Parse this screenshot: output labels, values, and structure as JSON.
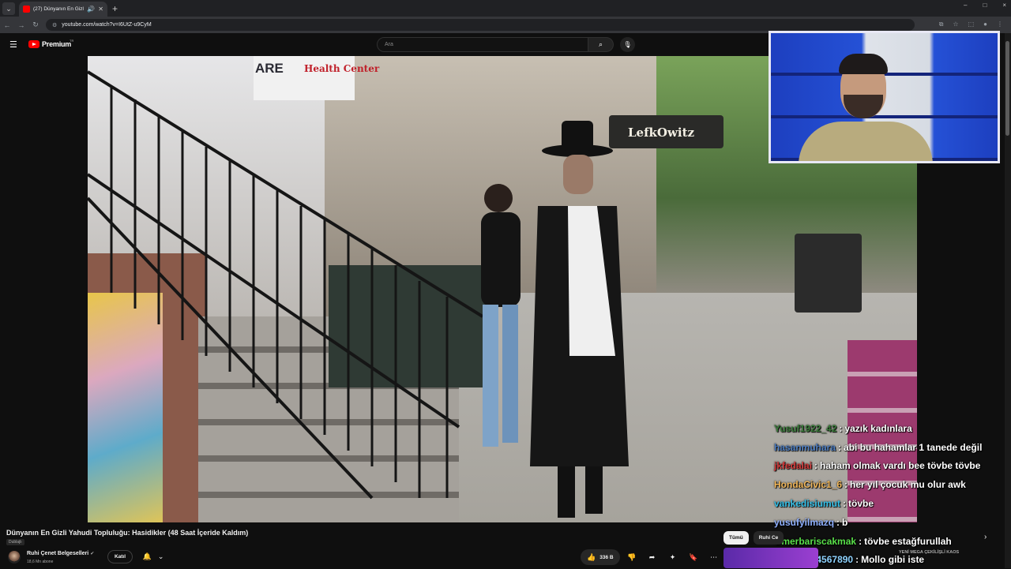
{
  "browser": {
    "tab_menu_icon": "chevron-down",
    "tab_title": "(27) Dünyanın En Gizli Yahu",
    "url": "youtube.com/watch?v=I6UtZ-u9CyM",
    "window_controls": [
      "–",
      "□",
      "×"
    ]
  },
  "youtube": {
    "logo_text": "Premium",
    "logo_region": "TR",
    "search_placeholder": "Ara",
    "colors": {
      "brand": "#ff0000",
      "background": "#0f0f0f"
    }
  },
  "video_scene": {
    "sign_are": "ARE",
    "sign_health_center": "Health Center",
    "sign_store": "LefkOwitz"
  },
  "chat": [
    {
      "user": "Yusuf1922_42",
      "color": "#3b7d3b",
      "message": "yazık kadınlara"
    },
    {
      "user": "hasanmuhara",
      "color": "#4f7fc2",
      "message": "abi bu hahamlar 1 tanede değil"
    },
    {
      "user": "jkfedalai",
      "color": "#d43a3a",
      "message": "haham olmak vardı bee tövbe tövbe"
    },
    {
      "user": "HondaCivic1_6",
      "color": "#f0b65a",
      "message": "her yıl çocuk mu olur awk"
    },
    {
      "user": "vankedisiumut",
      "color": "#35c0e8",
      "message": "tövbe"
    },
    {
      "user": "yusufyilmazq",
      "color": "#8fb0ff",
      "message": "b"
    },
    {
      "user": "Omerbariscakmak",
      "color": "#59e04a",
      "message": "tövbe estağfurullah"
    },
    {
      "user": "Kayra1234567890",
      "color": "#8fd3ff",
      "message": "Mollo gibi iste"
    }
  ],
  "video_info": {
    "title": "Dünyanın En Gizli Yahudi Topluluğu: Hasidikler (48 Saat İçeride Kaldım)",
    "dub_badge": "Dublajlı",
    "channel_name": "Ruhi Çenet Belgeselleri",
    "subscribers": "18,6 Mn abone",
    "join_label": "Katıl",
    "like_count": "336 B"
  },
  "sidebar": {
    "chips": [
      "Tümü",
      "Ruhi Ce"
    ],
    "rec_title": "YENİ MEGA ÇEKİLİŞLİ KAOS"
  }
}
